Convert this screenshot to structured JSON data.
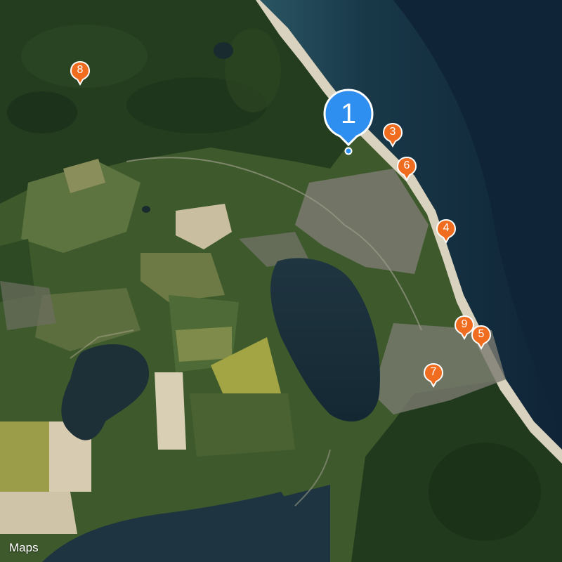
{
  "map": {
    "type": "satellite",
    "colors": {
      "sea_deep": "#0f2436",
      "sea_shallow": "#244a5a",
      "forest": "#243d1e",
      "field": "#5b6e3b",
      "lake": "#1d3038",
      "sand": "#d9d2be",
      "town": "#7b7a70"
    }
  },
  "selected_pin": {
    "label": "1",
    "color": "#2f8ff0",
    "icon": "map-pin-selected"
  },
  "pins": [
    {
      "label": "3",
      "color": "#f06c1e"
    },
    {
      "label": "6",
      "color": "#f06c1e"
    },
    {
      "label": "4",
      "color": "#f06c1e"
    },
    {
      "label": "9",
      "color": "#f06c1e"
    },
    {
      "label": "5",
      "color": "#f06c1e"
    },
    {
      "label": "7",
      "color": "#f06c1e"
    },
    {
      "label": "8",
      "color": "#f06c1e"
    }
  ],
  "attribution": {
    "apple_logo": "",
    "text": "Maps"
  }
}
